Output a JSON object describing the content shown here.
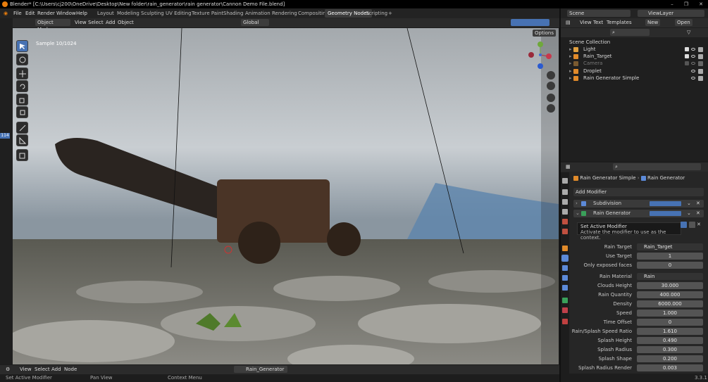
{
  "window": {
    "title": "Blender* [C:\\Users\\cj200\\OneDrive\\Desktop\\New folder\\rain_generator\\rain generator\\Cannon Demo File.blend]"
  },
  "menus": [
    "File",
    "Edit",
    "Render",
    "Window",
    "Help"
  ],
  "workspaces": [
    "Layout",
    "Modeling",
    "Sculpting",
    "UV Editing",
    "Texture Paint",
    "Shading",
    "Animation",
    "Rendering",
    "Compositing",
    "Geometry Nodes",
    "Scripting",
    "+"
  ],
  "scene": {
    "label": "Scene",
    "view_layer": "ViewLayer"
  },
  "viewport_header": {
    "mode": "Object Mode",
    "view": "View",
    "select": "Select",
    "add": "Add",
    "object": "Object",
    "orientation": "Global",
    "options": "Options"
  },
  "viewport": {
    "sample": "Sample 10/1024",
    "frame": "114"
  },
  "outliner": {
    "header": {
      "view": "View",
      "text": "Text",
      "templates": "Templates",
      "new": "New",
      "open": "Open"
    },
    "root": "Scene Collection",
    "items": [
      {
        "name": "Light"
      },
      {
        "name": "Rain_Target"
      },
      {
        "name": "Camera"
      },
      {
        "name": "Droplet"
      },
      {
        "name": "Rain Generator Simple"
      }
    ]
  },
  "properties": {
    "breadcrumb_object": "Rain Generator Simple",
    "breadcrumb_modifier": "Rain Generator",
    "add_modifier": "Add Modifier",
    "modifiers": [
      "Subdivision",
      "Rain Generator"
    ],
    "tooltip": {
      "title": "Set Active Modifier",
      "desc": "Activate the modifier to use as the context."
    },
    "rows": [
      {
        "label": "Rain Target",
        "value": "Rain_Target"
      },
      {
        "label": "Use Target",
        "value": "1"
      },
      {
        "label": "Only exposed faces",
        "value": "0"
      },
      {
        "label": "Rain Material",
        "value": "Rain"
      },
      {
        "label": "Clouds Height",
        "value": "30.000"
      },
      {
        "label": "Rain Quantity",
        "value": "400.000"
      },
      {
        "label": "Density",
        "value": "6000.000"
      },
      {
        "label": "Speed",
        "value": "1.000"
      },
      {
        "label": "Time Offset",
        "value": "0"
      },
      {
        "label": "Rain/Splash Speed Ratio",
        "value": "1.610"
      },
      {
        "label": "Splash Height",
        "value": "0.490"
      },
      {
        "label": "Splash Radius",
        "value": "0.300"
      },
      {
        "label": "Splash Shape",
        "value": "0.200"
      },
      {
        "label": "Splash Radius Render",
        "value": "0.003"
      }
    ]
  },
  "node_editor_header": {
    "view": "View",
    "select": "Select",
    "add": "Add",
    "node": "Node",
    "tree": "Rain_Generator"
  },
  "statusbar": {
    "left": "Set Active Modifier",
    "middle": "Pan View",
    "right": "Context Menu",
    "version": "3.3.1"
  },
  "colors": {
    "accent": "#4772b3",
    "orange": "#e87d0d",
    "active_tab": "#3b3b3b"
  }
}
